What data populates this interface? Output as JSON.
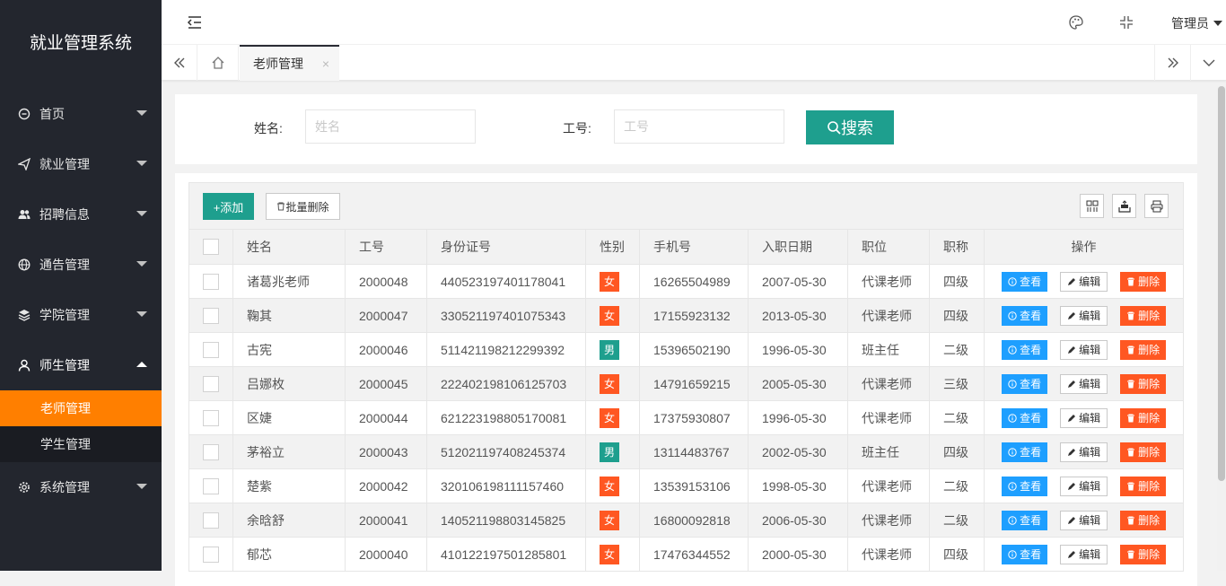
{
  "app": {
    "title": "就业管理系统"
  },
  "sidebar": {
    "items": [
      {
        "label": "首页",
        "icon": "home-icon"
      },
      {
        "label": "就业管理",
        "icon": "send-icon"
      },
      {
        "label": "招聘信息",
        "icon": "users-icon"
      },
      {
        "label": "通告管理",
        "icon": "globe-icon"
      },
      {
        "label": "学院管理",
        "icon": "layers-icon"
      },
      {
        "label": "师生管理",
        "icon": "user-icon"
      },
      {
        "label": "系统管理",
        "icon": "gear-icon"
      }
    ],
    "sub_items": [
      "老师管理",
      "学生管理"
    ]
  },
  "header": {
    "user": "管理员"
  },
  "tabs": {
    "active": "老师管理",
    "close": "×"
  },
  "search": {
    "name_label": "姓名:",
    "name_placeholder": "姓名",
    "id_label": "工号:",
    "id_placeholder": "工号",
    "button": "搜索"
  },
  "toolbar": {
    "add": "+添加",
    "batch_delete": "批量删除"
  },
  "table": {
    "headers": [
      "姓名",
      "工号",
      "身份证号",
      "性别",
      "手机号",
      "入职日期",
      "职位",
      "职称",
      "操作"
    ],
    "actions": {
      "view": "查看",
      "edit": "编辑",
      "delete": "删除"
    },
    "rows": [
      {
        "name": "诸葛兆老师",
        "id": "2000048",
        "idcard": "440523197401178041",
        "gender": "女",
        "phone": "16265504989",
        "date": "2007-05-30",
        "position": "代课老师",
        "title": "四级"
      },
      {
        "name": "鞠其",
        "id": "2000047",
        "idcard": "330521197401075343",
        "gender": "女",
        "phone": "17155923132",
        "date": "2013-05-30",
        "position": "代课老师",
        "title": "四级"
      },
      {
        "name": "古宪",
        "id": "2000046",
        "idcard": "511421198212299392",
        "gender": "男",
        "phone": "15396502190",
        "date": "1996-05-30",
        "position": "班主任",
        "title": "二级"
      },
      {
        "name": "吕娜枚",
        "id": "2000045",
        "idcard": "222402198106125703",
        "gender": "女",
        "phone": "14791659215",
        "date": "2005-05-30",
        "position": "代课老师",
        "title": "三级"
      },
      {
        "name": "区婕",
        "id": "2000044",
        "idcard": "621223198805170081",
        "gender": "女",
        "phone": "17375930807",
        "date": "1996-05-30",
        "position": "代课老师",
        "title": "二级"
      },
      {
        "name": "茅裕立",
        "id": "2000043",
        "idcard": "512021197408245374",
        "gender": "男",
        "phone": "13114483767",
        "date": "2002-05-30",
        "position": "班主任",
        "title": "四级"
      },
      {
        "name": "楚紫",
        "id": "2000042",
        "idcard": "320106198111157460",
        "gender": "女",
        "phone": "13539153106",
        "date": "1998-05-30",
        "position": "代课老师",
        "title": "二级"
      },
      {
        "name": "余晗舒",
        "id": "2000041",
        "idcard": "140521198803145825",
        "gender": "女",
        "phone": "16800092818",
        "date": "2006-05-30",
        "position": "代课老师",
        "title": "二级"
      },
      {
        "name": "郁芯",
        "id": "2000040",
        "idcard": "410122197501285801",
        "gender": "女",
        "phone": "17476344552",
        "date": "2000-05-30",
        "position": "代课老师",
        "title": "四级"
      }
    ]
  },
  "colors": {
    "sidebar": "#23262e",
    "accent": "#ff7f00",
    "primary": "#1e9f8e",
    "info": "#1e9fff",
    "danger": "#ff5722"
  }
}
